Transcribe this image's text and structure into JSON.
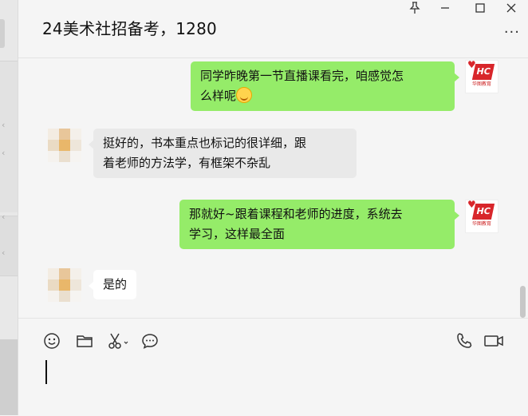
{
  "chat": {
    "title": "24美术社招备考，1280"
  },
  "window_controls": {
    "pin": "⚲",
    "minimize": "—",
    "maximize": "☐",
    "close": "✕",
    "more": "···"
  },
  "messages": [
    {
      "direction": "out",
      "line1": "同学昨晚第一节直播课看完，咱感觉怎",
      "line2": "么样呢"
    },
    {
      "direction": "in",
      "line1": "挺好的，书本重点也标记的很详细，跟",
      "line2": "着老师的方法学，有框架不杂乱"
    },
    {
      "direction": "out",
      "line1": "那就好~跟着课程和老师的进度，系统去",
      "line2": "学习，这样最全面"
    },
    {
      "direction": "in",
      "line1": "是的"
    }
  ],
  "self_avatar": {
    "logo_text": "HC",
    "sub_text": "华图教育"
  },
  "toolbar": {
    "icons": [
      "emoji-icon",
      "folder-icon",
      "scissors-icon",
      "chat-bubble-icon",
      "phone-icon",
      "video-icon"
    ]
  },
  "colors": {
    "outgoing_bubble": "#95ec69",
    "incoming_bubble": "#ffffff",
    "background": "#f5f5f5",
    "brand_red": "#d8262b"
  }
}
